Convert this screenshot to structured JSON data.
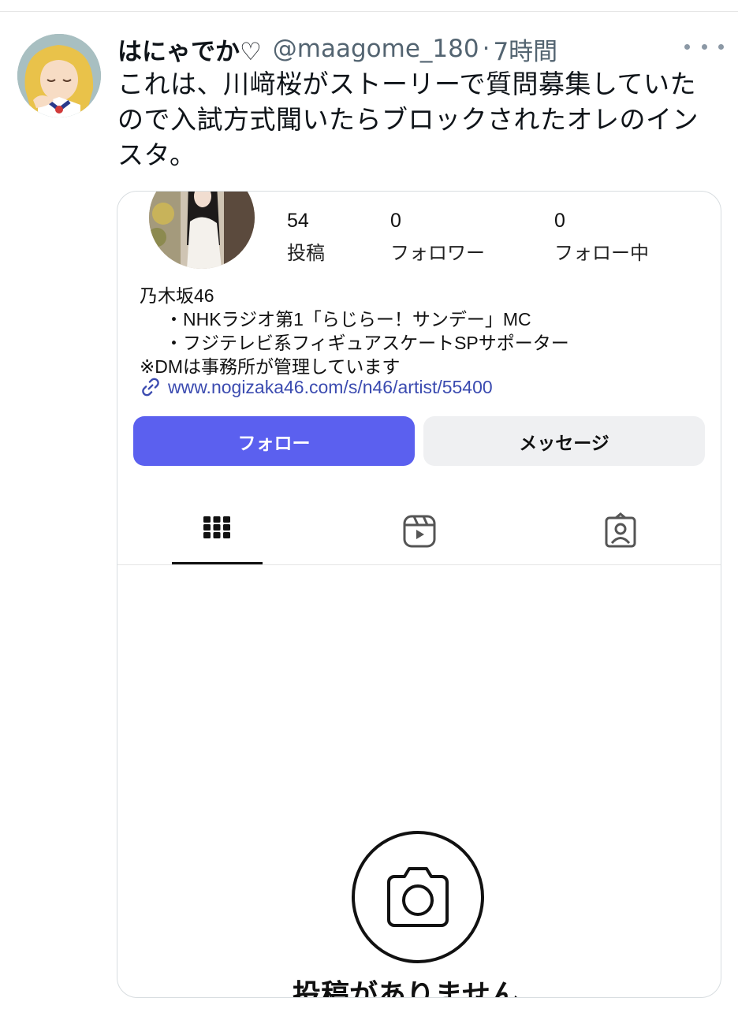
{
  "tweet": {
    "display_name": "はにゃでか♡",
    "handle": "@maagome_180",
    "separator": "·",
    "time": "7時間",
    "text_lines": [
      "これは、川﨑桜がストーリーで質問募集していた",
      "ので入試方式聞いたらブロックされたオレのイン",
      "スタ。"
    ],
    "avatar_icon": "user-avatar-icon",
    "more_icon": "more-icon"
  },
  "instagram": {
    "stats": {
      "posts": {
        "count": "54",
        "label": "投稿"
      },
      "followers": {
        "count": "0",
        "label": "フォロワー"
      },
      "following": {
        "count": "0",
        "label": "フォロー中"
      }
    },
    "bio": {
      "name": "乃木坂46",
      "line1": "・NHKラジオ第1「らじらー！サンデー」MC",
      "line2": "・フジテレビ系フィギュアスケートSPサポーター",
      "line3": "※DMは事務所が管理しています"
    },
    "link": "www.nogizaka46.com/s/n46/artist/55400",
    "buttons": {
      "follow": "フォロー",
      "message": "メッセージ"
    },
    "tabs": [
      "grid-icon",
      "reels-icon",
      "tagged-icon"
    ],
    "empty_state": {
      "icon": "camera-icon",
      "text": "投稿がありません"
    },
    "colors": {
      "follow_button": "#5b60ef",
      "message_button": "#eff0f2",
      "link": "#3b4bb0"
    }
  }
}
